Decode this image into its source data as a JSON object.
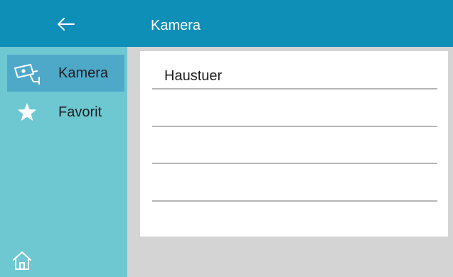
{
  "header": {
    "back_icon": "arrow-left-icon",
    "title": "Kamera"
  },
  "sidebar": {
    "items": [
      {
        "label": "Kamera",
        "icon": "security-camera-icon",
        "active": true
      },
      {
        "label": "Favorit",
        "icon": "star-icon",
        "active": false
      }
    ],
    "home_icon": "home-icon"
  },
  "camera_list": {
    "rows": [
      {
        "label": "Haustuer"
      },
      {
        "label": ""
      },
      {
        "label": ""
      },
      {
        "label": ""
      }
    ]
  },
  "colors": {
    "header_bg": "#0e8fb8",
    "sidebar_bg": "#6ec8d2",
    "active_item_bg": "#4ea9c9",
    "content_bg": "#ffffff",
    "page_bg": "#d4d4d4"
  }
}
